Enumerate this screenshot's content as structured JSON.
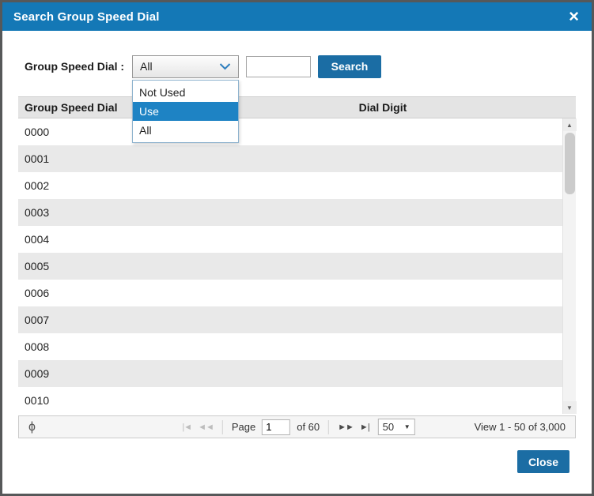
{
  "colors": {
    "header_blue": "#1478b6",
    "button_blue": "#1b6da4",
    "option_highlight": "#1e83c4",
    "row_alt": "#e9e9e9",
    "table_header_bg": "#e4e4e4"
  },
  "dialog": {
    "title": "Search Group Speed Dial",
    "close_icon": "×"
  },
  "form": {
    "label": "Group Speed Dial :",
    "select_value": "All",
    "options": [
      "Not Used",
      "Use",
      "All"
    ],
    "selected_option": "Use",
    "input_value": "",
    "search_label": "Search"
  },
  "table": {
    "col1": "Group Speed Dial",
    "col2": "Dial Digit",
    "rows": [
      "0000",
      "0001",
      "0002",
      "0003",
      "0004",
      "0005",
      "0006",
      "0007",
      "0008",
      "0009",
      "0010"
    ]
  },
  "scrollbar": {
    "up_icon": "▲",
    "down_icon": "▼"
  },
  "pager": {
    "refresh_icon": "ϕ",
    "first_icon": "|◄",
    "prev_icon": "◄◄",
    "page_label": "Page",
    "page_value": "1",
    "of_label": "of 60",
    "next_icon": "►►",
    "last_icon": "►|",
    "page_size": "50",
    "caret_icon": "▼",
    "view_text": "View 1 - 50 of 3,000"
  },
  "footer": {
    "close_label": "Close"
  }
}
